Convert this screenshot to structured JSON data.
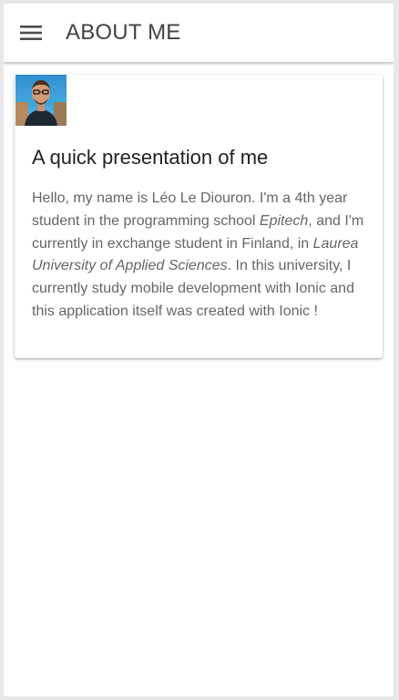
{
  "toolbar": {
    "menu_icon": "hamburger-menu-icon",
    "title": "ABOUT ME"
  },
  "card": {
    "avatar_icon": "profile-photo",
    "title": "A quick presentation of me",
    "body": {
      "part1": "Hello, my name is Léo Le Diouron. I'm a 4th year student in the programming school ",
      "school": "Epitech",
      "part2": ", and I'm currently in exchange student in Finland, in ",
      "university": "Laurea University of Applied Sciences",
      "part3": ". In this university, I currently study mobile development with Ionic and this application itself was created with Ionic !"
    }
  },
  "colors": {
    "toolbar_background": "#ffffff",
    "title_text": "#424242",
    "body_text": "#666666",
    "card_title_text": "#222222"
  }
}
